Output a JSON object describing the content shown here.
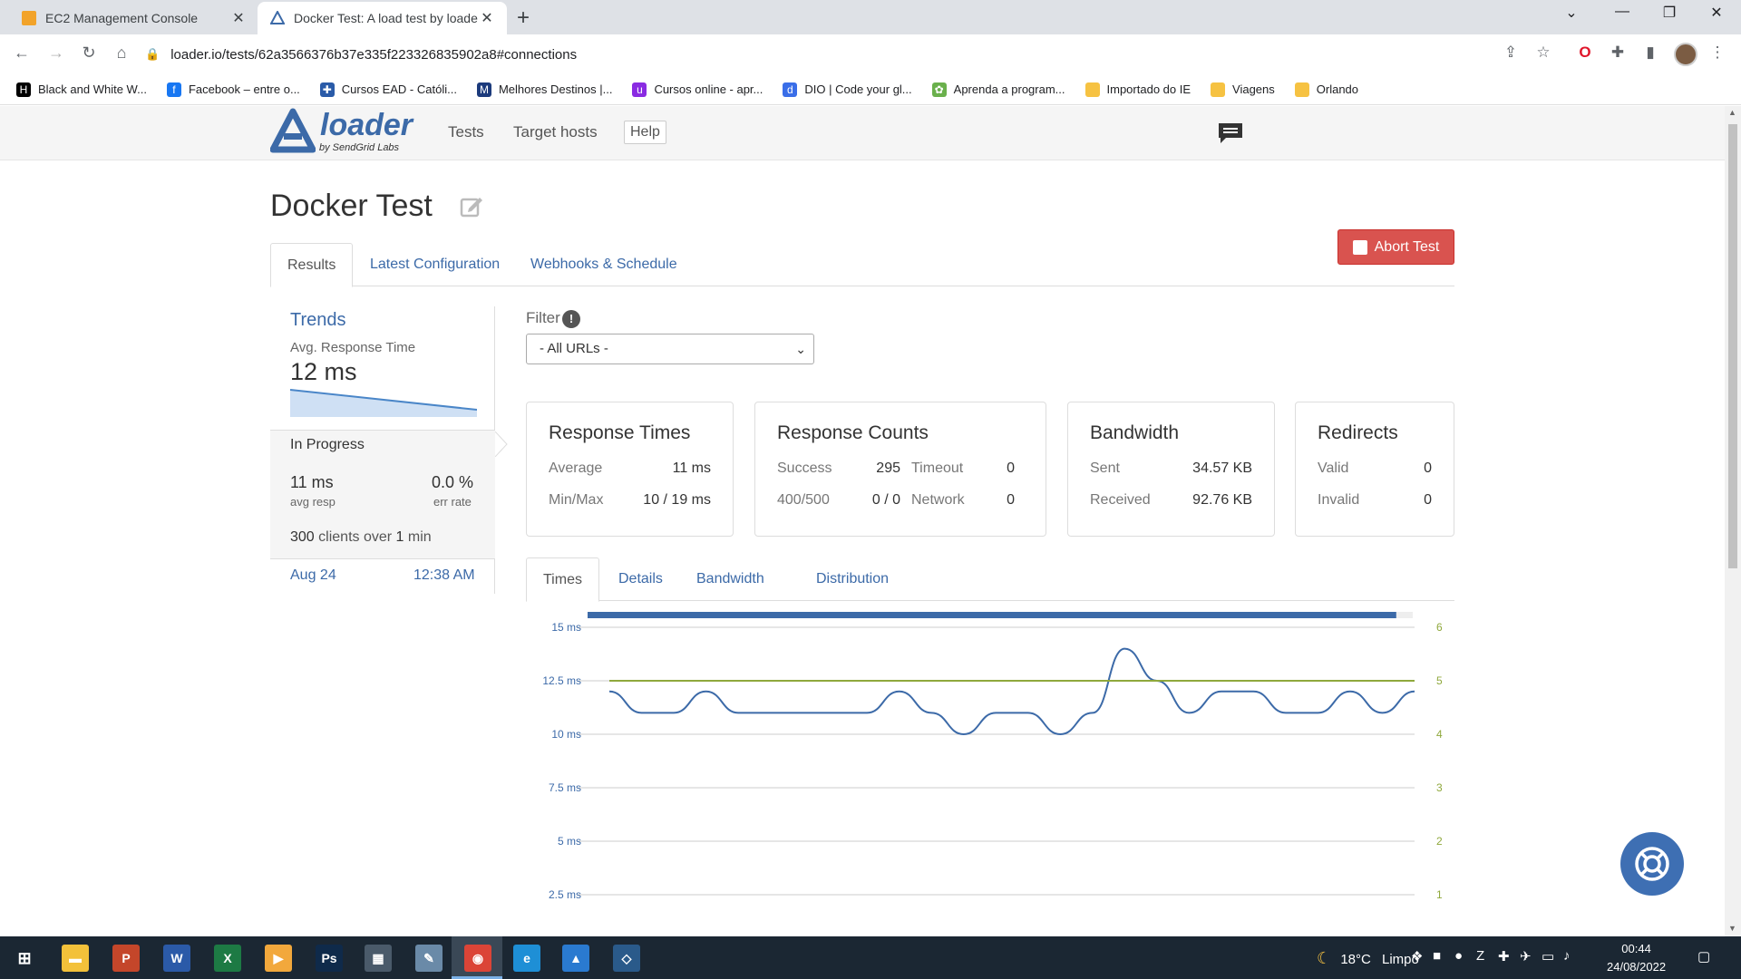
{
  "browser": {
    "tabs": [
      {
        "title": "EC2 Management Console",
        "icon": "aws-icon",
        "color": "#f2a32a"
      },
      {
        "title": "Docker Test: A load test by loade",
        "icon": "loader-icon",
        "color": "#3c6aa8"
      }
    ],
    "url": "loader.io/tests/62a3566376b37e335f223326835902a8#connections",
    "bookmarks": [
      {
        "label": "Black and White W...",
        "color": "#000000",
        "glyph": "H"
      },
      {
        "label": "Facebook – entre o...",
        "color": "#1877f2",
        "glyph": "f"
      },
      {
        "label": "Cursos EAD - Católi...",
        "color": "#2a5ba8",
        "glyph": "✚"
      },
      {
        "label": "Melhores Destinos |...",
        "color": "#1c3b7c",
        "glyph": "M"
      },
      {
        "label": "Cursos online - apr...",
        "color": "#8a2be2",
        "glyph": "u"
      },
      {
        "label": "DIO | Code your gl...",
        "color": "#3a6ee8",
        "glyph": "d"
      },
      {
        "label": "Aprenda a program...",
        "color": "#6ab04c",
        "glyph": "✿"
      },
      {
        "label": "Importado do IE",
        "color": "#f6c242",
        "glyph": ""
      },
      {
        "label": "Viagens",
        "color": "#f6c242",
        "glyph": ""
      },
      {
        "label": "Orlando",
        "color": "#f6c242",
        "glyph": ""
      }
    ]
  },
  "header": {
    "logo": "loader",
    "logo_sub": "by SendGrid Labs",
    "nav": [
      "Tests",
      "Target hosts"
    ],
    "help": "Help"
  },
  "page": {
    "title": "Docker Test",
    "tabs": [
      "Results",
      "Latest Configuration",
      "Webhooks & Schedule"
    ],
    "abort_label": "Abort Test"
  },
  "summary": {
    "trends": "Trends",
    "avg_label": "Avg. Response Time",
    "avg_value": "12 ms",
    "status": "In Progress",
    "avg_resp_value": "11 ms",
    "avg_resp_label": "avg resp",
    "err_value": "0.0 %",
    "err_label": "err rate",
    "clients_count": "300",
    "clients_mid": "clients over",
    "clients_dur": "1",
    "clients_unit": "min",
    "date": "Aug 24",
    "time": "12:38 AM"
  },
  "filter": {
    "label": "Filter",
    "info": "!",
    "selected": "- All URLs -"
  },
  "cards": {
    "response_times": {
      "title": "Response Times",
      "average_label": "Average",
      "average": "11 ms",
      "minmax_label": "Min/Max",
      "minmax": "10 / 19 ms"
    },
    "response_counts": {
      "title": "Response Counts",
      "success_label": "Success",
      "success": "295",
      "timeout_label": "Timeout",
      "timeout": "0",
      "err_label": "400/500",
      "err": "0 / 0",
      "network_label": "Network",
      "network": "0"
    },
    "bandwidth": {
      "title": "Bandwidth",
      "sent_label": "Sent",
      "sent": "34.57 KB",
      "received_label": "Received",
      "received": "92.76 KB"
    },
    "redirects": {
      "title": "Redirects",
      "valid_label": "Valid",
      "valid": "0",
      "invalid_label": "Invalid",
      "invalid": "0"
    }
  },
  "subtabs": [
    "Times",
    "Details",
    "Bandwidth",
    "Distribution"
  ],
  "chart_data": {
    "type": "line",
    "progress": 0.98,
    "y_left_ticks": [
      "15 ms",
      "12.5 ms",
      "10 ms",
      "7.5 ms",
      "5 ms",
      "2.5 ms"
    ],
    "y_right_ticks": [
      "6",
      "5",
      "4",
      "3",
      "2",
      "1"
    ],
    "ylim_left": [
      0,
      15
    ],
    "ylim_right": [
      0,
      6
    ],
    "series": [
      {
        "color": "#3c6aa8",
        "axis": "left",
        "values": [
          12,
          11,
          11,
          12,
          11,
          11,
          11,
          11,
          11,
          12,
          11,
          10,
          11,
          11,
          10,
          11,
          14,
          12.5,
          11,
          12,
          12,
          11,
          11,
          12,
          11,
          12
        ]
      },
      {
        "color": "#8fa83c",
        "axis": "right",
        "values": [
          5,
          5,
          5,
          5,
          5,
          5,
          5,
          5,
          5,
          5,
          5,
          5,
          5,
          5,
          5,
          5,
          5,
          5,
          5,
          5,
          5,
          5,
          5,
          5,
          5,
          5
        ]
      }
    ],
    "grid": true
  },
  "taskbar": {
    "apps": [
      {
        "name": "file-explorer-icon",
        "color": "#f3c13a",
        "glyph": "▬"
      },
      {
        "name": "powerpoint-icon",
        "color": "#c4462a",
        "glyph": "P"
      },
      {
        "name": "word-icon",
        "color": "#2b5aa8",
        "glyph": "W"
      },
      {
        "name": "excel-icon",
        "color": "#1d7a44",
        "glyph": "X"
      },
      {
        "name": "media-player-icon",
        "color": "#f2a83c",
        "glyph": "▶"
      },
      {
        "name": "photoshop-icon",
        "color": "#0f2a4a",
        "glyph": "Ps"
      },
      {
        "name": "calculator-icon",
        "color": "#4a5a6a",
        "glyph": "▦"
      },
      {
        "name": "paint-icon",
        "color": "#6a8aa8",
        "glyph": "✎"
      },
      {
        "name": "chrome-icon",
        "color": "#db4437",
        "glyph": "◉"
      },
      {
        "name": "edge-icon",
        "color": "#1e8fd6",
        "glyph": "e"
      },
      {
        "name": "photos-icon",
        "color": "#2a7ad0",
        "glyph": "▲"
      },
      {
        "name": "mysql-workbench-icon",
        "color": "#2a5a8a",
        "glyph": "◇"
      }
    ],
    "temp": "18°C",
    "weather": "Limpo",
    "time": "00:44",
    "date": "24/08/2022"
  }
}
